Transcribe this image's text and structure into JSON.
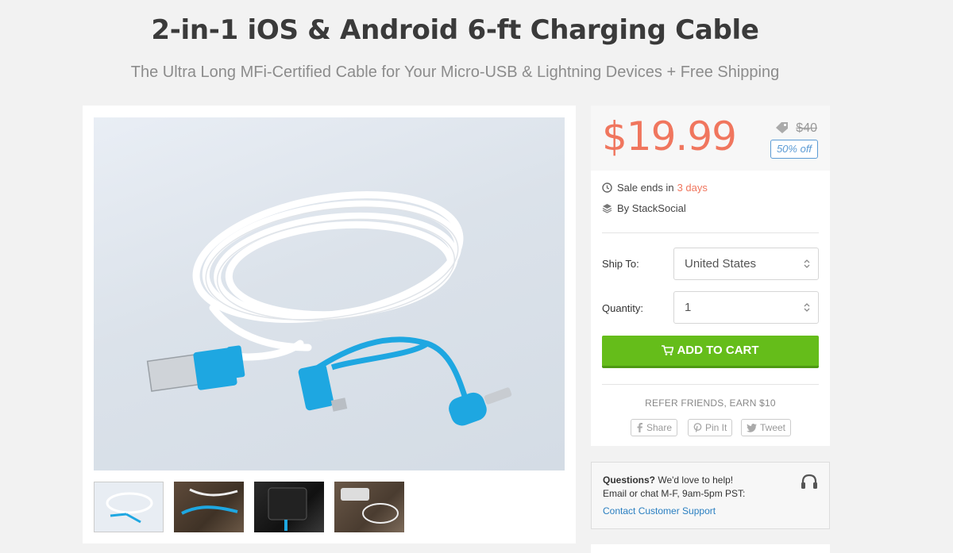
{
  "product": {
    "title": "2-in-1 iOS & Android 6-ft Charging Cable",
    "subtitle": "The Ultra Long MFi-Certified Cable for Your Micro-USB & Lightning Devices + Free Shipping"
  },
  "pricing": {
    "price": "$19.99",
    "original_price": "$40",
    "discount": "50% off",
    "sale_prefix": "Sale ends in ",
    "sale_remaining": "3 days",
    "seller": "By StackSocial"
  },
  "form": {
    "ship_to_label": "Ship To:",
    "ship_to_value": "United States",
    "quantity_label": "Quantity:",
    "quantity_value": "1",
    "add_to_cart": "ADD TO CART"
  },
  "social": {
    "refer": "REFER FRIENDS, EARN $10",
    "share": "Share",
    "pin": "Pin It",
    "tweet": "Tweet"
  },
  "help": {
    "questions": "Questions?",
    "questions_rest": " We'd love to help!",
    "hours": "Email or chat M-F, 9am-5pm PST:",
    "contact": "Contact Customer Support"
  },
  "colors": {
    "price": "#f0765e",
    "cart_button": "#65bd1a",
    "link": "#2a7fc1",
    "cable_accent": "#1ea7e1"
  },
  "icons": [
    "tag-icon",
    "clock-icon",
    "layers-icon",
    "cart-icon",
    "facebook-icon",
    "pinterest-icon",
    "twitter-icon",
    "headset-icon"
  ]
}
